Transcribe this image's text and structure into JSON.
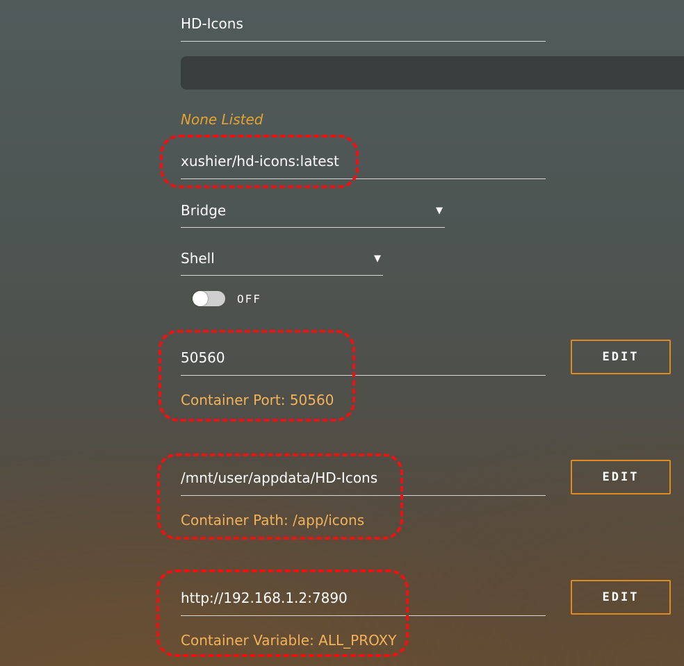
{
  "form": {
    "name_value": "HD-Icons",
    "overview_value": "",
    "additional_requirements": "None Listed",
    "repository_value": "xushier/hd-icons:latest",
    "network_type": "Bridge",
    "console_shell": "Shell",
    "privileged_toggle": "OFF"
  },
  "port": {
    "value": "50560",
    "hint": "Container Port: 50560",
    "edit_label": "EDIT"
  },
  "path": {
    "value": "/mnt/user/appdata/HD-Icons",
    "hint": "Container Path: /app/icons",
    "edit_label": "EDIT"
  },
  "variable": {
    "value": "http://192.168.1.2:7890",
    "hint": "Container Variable: ALL_PROXY",
    "edit_label": "EDIT"
  },
  "icons": {
    "dropdown": "triangle-down",
    "highlight": "red-dashed-outline"
  },
  "colors": {
    "accent_orange": "#e08a22",
    "hint_text": "#f4b25a",
    "highlight_red": "#ee1111"
  }
}
